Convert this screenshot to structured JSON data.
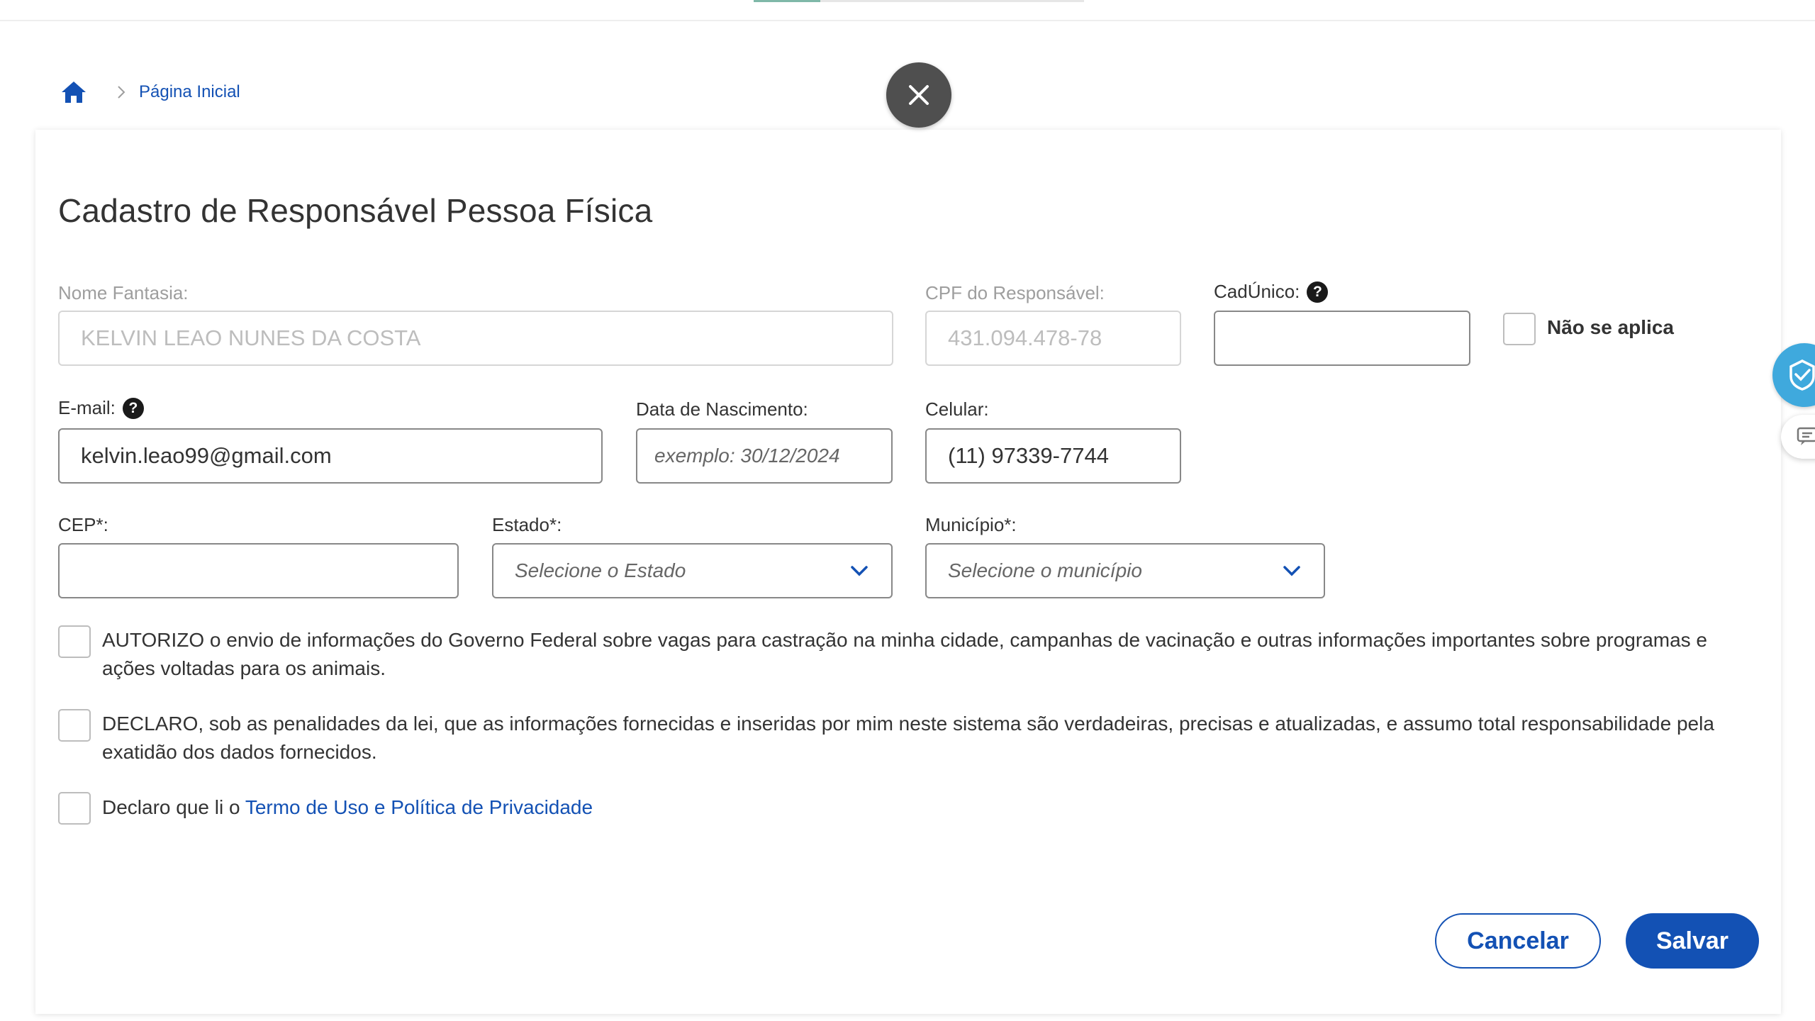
{
  "breadcrumb": {
    "current": "Página Inicial"
  },
  "form": {
    "title": "Cadastro de Responsável Pessoa Física",
    "nome_fantasia": {
      "label": "Nome Fantasia:",
      "value": "KELVIN LEAO NUNES DA COSTA"
    },
    "cpf": {
      "label": "CPF do Responsável:",
      "value": "431.094.478-78"
    },
    "cadunico": {
      "label": "CadÚnico:",
      "value": "",
      "nao_se_aplica": "Não se aplica"
    },
    "email": {
      "label": "E-mail:",
      "value": "kelvin.leao99@gmail.com"
    },
    "nascimento": {
      "label": "Data de Nascimento:",
      "placeholder": "exemplo: 30/12/2024"
    },
    "celular": {
      "label": "Celular:",
      "value": "(11) 97339-7744"
    },
    "cep": {
      "label": "CEP*:",
      "value": ""
    },
    "estado": {
      "label": "Estado*:",
      "placeholder": "Selecione o Estado"
    },
    "municipio": {
      "label": "Município*:",
      "placeholder": "Selecione o município"
    },
    "consent_autorizo": "AUTORIZO o envio de informações do Governo Federal sobre vagas para castração na minha cidade, campanhas de vacinação e outras informações importantes sobre programas e ações voltadas para os animais.",
    "consent_declaro": "DECLARO, sob as penalidades da lei, que as informações fornecidas e inseridas por mim neste sistema são verdadeiras, precisas e atualizadas, e assumo total responsabilidade pela exatidão dos dados fornecidos.",
    "consent_termo_prefix": "Declaro que li o ",
    "consent_termo_link": "Termo de Uso e Política de Privacidade",
    "cancel_label": "Cancelar",
    "save_label": "Salvar"
  },
  "icons": {
    "home": "home-icon",
    "close": "close-icon",
    "help": "help-circle-icon",
    "chevron": "chevron-down-icon"
  },
  "colors": {
    "primary": "#1351b4",
    "close_bg": "#4f4f4f",
    "side_badge": "#3fa9dd"
  }
}
